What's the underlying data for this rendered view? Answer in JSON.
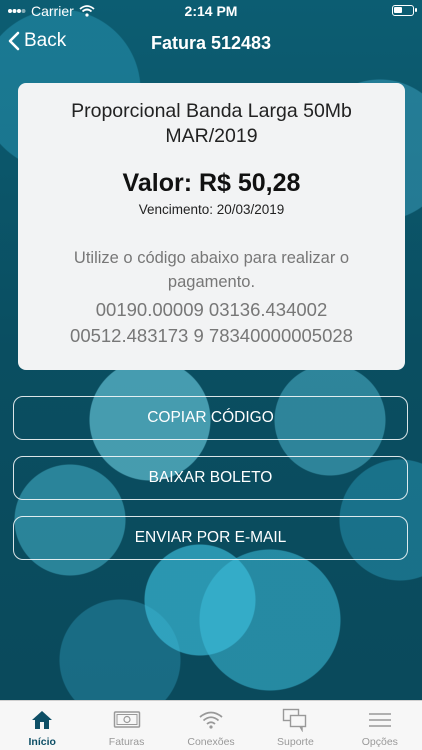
{
  "status_bar": {
    "carrier": "Carrier",
    "time": "2:14 PM"
  },
  "nav": {
    "back_label": "Back",
    "title": "Fatura 512483"
  },
  "invoice": {
    "product_line1": "Proporcional Banda Larga 50Mb",
    "product_line2": "MAR/2019",
    "amount": "Valor: R$ 50,28",
    "due_date": "Vencimento: 20/03/2019",
    "instruction_line1": "Utilize o código abaixo para realizar o",
    "instruction_line2": "pagamento.",
    "barcode_line1": "00190.00009 03136.434002",
    "barcode_line2": "00512.483173 9 78340000005028"
  },
  "actions": {
    "copy_label": "COPIAR CÓDIGO",
    "download_label": "BAIXAR BOLETO",
    "email_label": "ENVIAR POR E-MAIL"
  },
  "tabs": [
    {
      "label": "Início",
      "icon": "home-icon",
      "active": true
    },
    {
      "label": "Faturas",
      "icon": "bill-icon",
      "active": false
    },
    {
      "label": "Conexões",
      "icon": "wifi-icon",
      "active": false
    },
    {
      "label": "Suporte",
      "icon": "chat-icon",
      "active": false
    },
    {
      "label": "Opções",
      "icon": "menu-icon",
      "active": false
    }
  ],
  "colors": {
    "active_tab": "#0e4f66",
    "inactive_tab": "#999999",
    "background": "#0b5568"
  }
}
